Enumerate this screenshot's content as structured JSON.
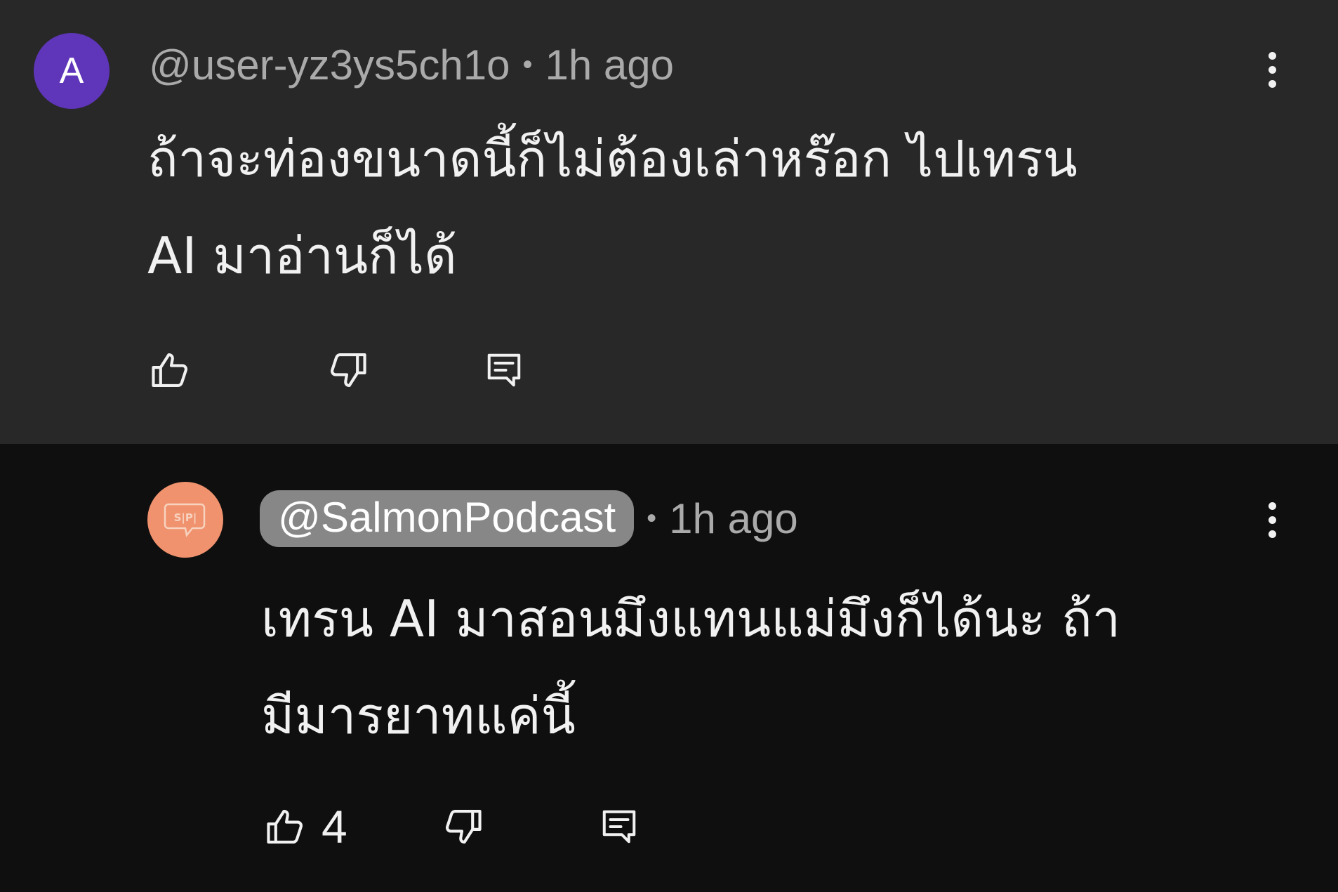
{
  "comments": [
    {
      "avatar_letter": "A",
      "avatar_color": "#5f35b9",
      "handle": "@user-yz3ys5ch1o",
      "separator": "•",
      "time": "1h ago",
      "text_line1": "ถ้าจะท่องขนาดนี้ก็ไม่ต้องเล่าหร๊อก ไปเทรน",
      "text_line2": "AI มาอ่านก็ได้",
      "like_count": "",
      "icons": [
        "thumbs-up-icon",
        "thumbs-down-icon",
        "reply-icon",
        "more-vert-icon"
      ]
    },
    {
      "avatar_color": "#f0926e",
      "avatar_logo_text": "S|P|",
      "handle": "@SalmonPodcast",
      "handle_is_creator": true,
      "separator": "•",
      "time": "1h ago",
      "text_line1": "เทรน AI มาสอนมึงแทนแม่มึงก็ได้นะ ถ้า",
      "text_line2": "มีมารยาทแค่นี้",
      "like_count": "4",
      "icons": [
        "thumbs-up-icon",
        "thumbs-down-icon",
        "reply-icon",
        "more-vert-icon"
      ]
    }
  ],
  "colors": {
    "comment1_bg": "#282828",
    "comment2_bg": "#0f0f0f",
    "secondary_text": "#aaaaaa",
    "primary_text": "#f1f1f1",
    "creator_pill": "#878787"
  }
}
